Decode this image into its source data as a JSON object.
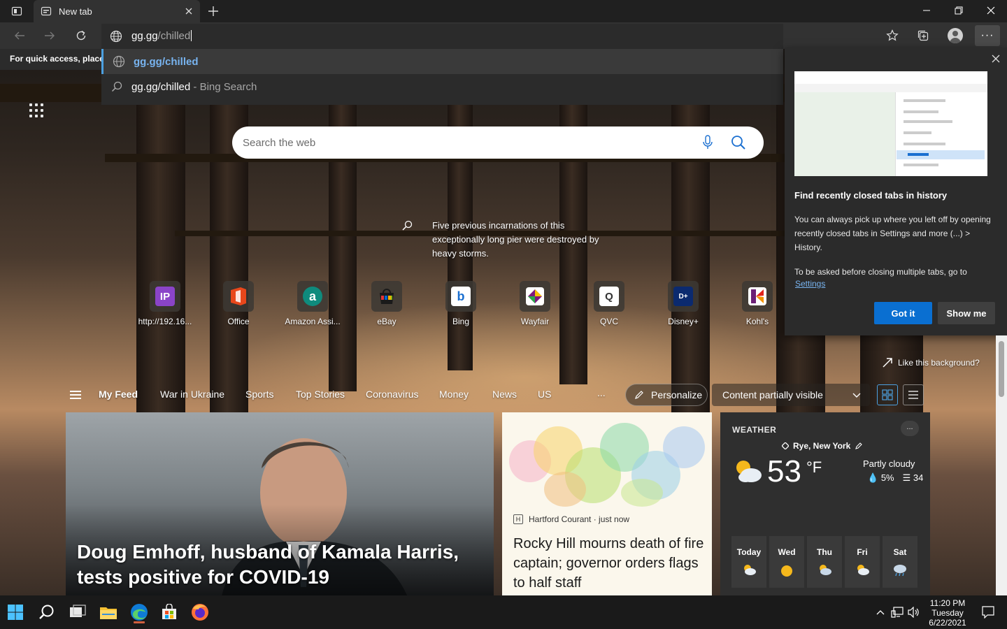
{
  "browser": {
    "tab_title": "New tab",
    "address": {
      "typed": "gg.gg",
      "completion": "/chilled"
    },
    "favorites_hint": "For quick access, place y"
  },
  "suggestions": [
    {
      "text": "gg.gg/chilled",
      "suffix": "",
      "icon": "globe-icon"
    },
    {
      "text": "gg.gg/chilled",
      "suffix": " - Bing Search",
      "icon": "search-icon"
    }
  ],
  "newtab": {
    "search_placeholder": "Search the web",
    "caption": "Five previous incarnations of this exceptionally long pier were destroyed by heavy storms.",
    "like_background": "Like this background?",
    "top_sites": [
      {
        "label": "http://192.16...",
        "icon": "ip-icon"
      },
      {
        "label": "Office",
        "icon": "office-icon"
      },
      {
        "label": "Amazon Assi...",
        "icon": "amazon-icon"
      },
      {
        "label": "eBay",
        "icon": "ebay-icon"
      },
      {
        "label": "Bing",
        "icon": "bing-icon"
      },
      {
        "label": "Wayfair",
        "icon": "wayfair-icon"
      },
      {
        "label": "QVC",
        "icon": "qvc-icon"
      },
      {
        "label": "Disney+",
        "icon": "disney-icon"
      },
      {
        "label": "Kohl's",
        "icon": "kohls-icon"
      }
    ]
  },
  "feed": {
    "nav": [
      "My Feed",
      "War in Ukraine",
      "Sports",
      "Top Stories",
      "Coronavirus",
      "Money",
      "News",
      "US"
    ],
    "more": "...",
    "personalize": "Personalize",
    "visibility": "Content partially visible",
    "main_story": "Doug Emhoff, husband of Kamala Harris, tests positive for COVID-19",
    "side_story": {
      "source": "Hartford Courant · just now",
      "headline": "Rocky Hill mourns death of fire captain; governor orders flags to half staff"
    }
  },
  "weather": {
    "title": "WEATHER",
    "more": "...",
    "location": "Rye, New York",
    "temp": "53",
    "unit": "°F",
    "condition": "Partly cloudy",
    "precip": "5%",
    "wind": "34",
    "days": [
      "Today",
      "Wed",
      "Thu",
      "Fri",
      "Sat"
    ],
    "day_icons": [
      "partly-cloudy-icon",
      "sunny-icon",
      "partly-cloudy-icon",
      "partly-cloudy-icon",
      "rain-icon"
    ]
  },
  "flyout": {
    "title": "Find recently closed tabs in history",
    "body": "You can always pick up where you left off by opening recently closed tabs in Settings and more (...) > History.",
    "body2": "To be asked before closing multiple tabs, go to",
    "link": "Settings",
    "primary": "Got it",
    "secondary": "Show me"
  },
  "taskbar": {
    "time": "11:20 PM",
    "day": "Tuesday",
    "date": "6/22/2021"
  },
  "colors": {
    "accent": "#0a6fd1",
    "link": "#78b4f0",
    "toolbar": "#323232",
    "titlebar": "#202020"
  }
}
